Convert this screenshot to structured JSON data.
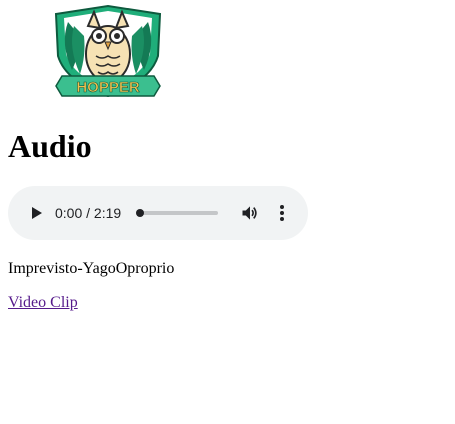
{
  "logo": {
    "text": "HOPPER",
    "colors": {
      "shield": "#1fae7a",
      "shield_dark": "#0e5a3e",
      "owl_body": "#f6e2b4",
      "owl_outline": "#2b2b2b",
      "banner": "#3bbf8f",
      "banner_text": "#f2c14e"
    }
  },
  "page": {
    "heading": "Audio"
  },
  "audio_player": {
    "current_time": "0:00",
    "duration": "2:19",
    "time_display": "0:00 / 2:19",
    "progress": 0,
    "icons": {
      "play": "play-icon",
      "volume": "volume-icon",
      "menu": "more-vert-icon"
    },
    "colors": {
      "background": "#f1f3f4",
      "foreground": "#202124"
    }
  },
  "track": {
    "title": "Imprevisto-YagoOproprio"
  },
  "links": {
    "video_clip": "Video Clip"
  }
}
